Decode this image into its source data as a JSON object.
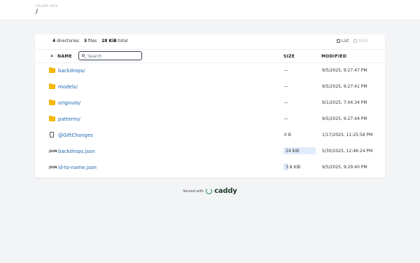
{
  "header": {
    "folder_label": "FOLDER PATH",
    "path": "/"
  },
  "summary": {
    "directories_count": "4",
    "directories_label": "directories",
    "files_count": "3",
    "files_label": "files",
    "total_size": "28 KiB",
    "total_label": "total"
  },
  "view": {
    "list_label": "List",
    "grid_label": "Grid",
    "active": "list"
  },
  "table": {
    "col_name": "NAME",
    "col_size": "SIZE",
    "col_modified": "MODIFIED",
    "search_placeholder": "Search",
    "rows": [
      {
        "icon": "folder-icon",
        "name": "backdrops/",
        "size": "—",
        "modified": "9/5/2025, 9:27:47 PM"
      },
      {
        "icon": "folder-icon",
        "name": "models/",
        "size": "—",
        "modified": "9/5/2025, 9:27:41 PM"
      },
      {
        "icon": "folder-icon",
        "name": "originals/",
        "size": "—",
        "modified": "9/1/2025, 7:04:34 PM"
      },
      {
        "icon": "folder-icon",
        "name": "patterns/",
        "size": "—",
        "modified": "9/5/2025, 9:27:44 PM"
      },
      {
        "icon": "file-icon",
        "name": "@GiftChanges",
        "size": "0 B",
        "modified": "1/17/2025, 11:25:58 PM"
      },
      {
        "icon": "json-icon",
        "name": "backdrops.json",
        "size": "24 KiB",
        "modified": "5/30/2025, 12:46:24 PM",
        "size_fraction": 1.0
      },
      {
        "icon": "json-icon",
        "name": "id-to-name.json",
        "size": "3.8 KiB",
        "modified": "9/5/2025, 9:29:40 PM",
        "size_fraction": 0.15
      }
    ]
  },
  "footer": {
    "served_with": "Served with",
    "brand": "caddy"
  },
  "colors": {
    "folder": "#f5b70b",
    "link": "#1d64b3",
    "size_bar": "#e0ecfb",
    "brand_green": "#1f8a4c"
  }
}
